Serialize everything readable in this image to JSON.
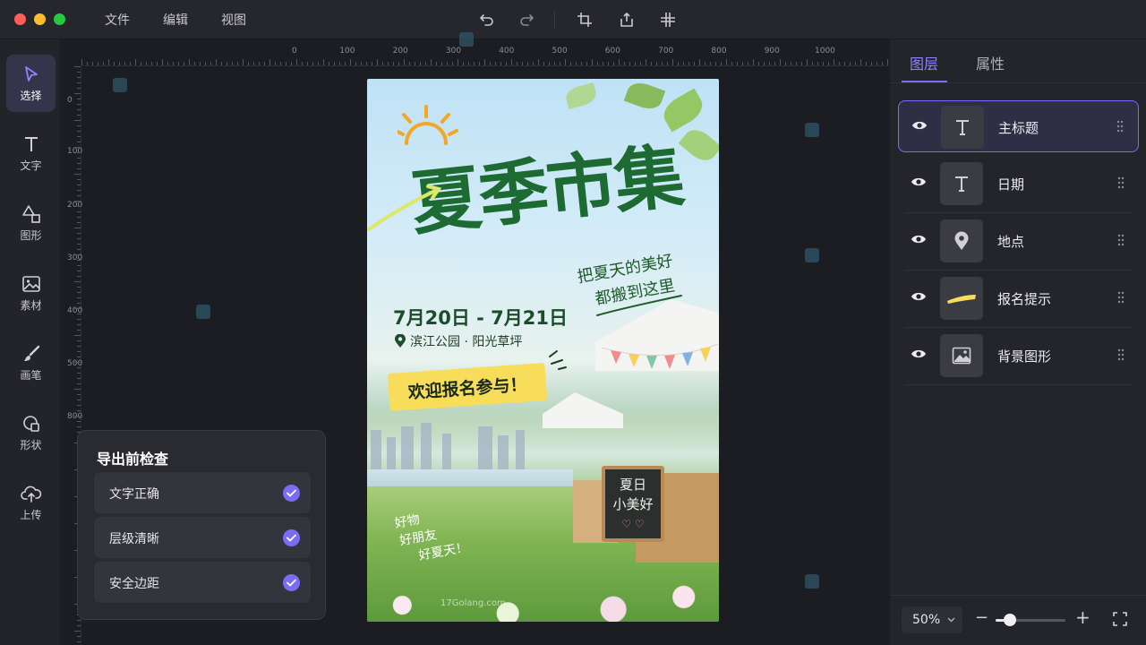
{
  "window": {
    "traffic_colors": [
      "#fe5f57",
      "#febc2e",
      "#28c840"
    ]
  },
  "menu": {
    "items": [
      "文件",
      "编辑",
      "视图"
    ]
  },
  "toolbar": {
    "icons": [
      "undo-icon",
      "redo-icon",
      "crop-icon",
      "export-icon",
      "align-icon"
    ]
  },
  "left_tools": [
    {
      "label": "选择",
      "icon": "cursor-icon",
      "active": true
    },
    {
      "label": "文字",
      "icon": "text-icon",
      "active": false
    },
    {
      "label": "图形",
      "icon": "shapes-icon",
      "active": false
    },
    {
      "label": "素材",
      "icon": "image-icon",
      "active": false
    },
    {
      "label": "画笔",
      "icon": "brush-icon",
      "active": false
    },
    {
      "label": "形状",
      "icon": "shape-icon",
      "active": false
    },
    {
      "label": "上传",
      "icon": "upload-icon",
      "active": false
    }
  ],
  "ruler": {
    "top": [
      "0",
      "100",
      "200",
      "300",
      "400",
      "500",
      "600",
      "700",
      "800",
      "900",
      "1000"
    ],
    "left": [
      "0",
      "100",
      "200",
      "300",
      "400",
      "500",
      "800"
    ]
  },
  "poster": {
    "title": "夏季市集",
    "slogan_line1": "把夏天的美好",
    "slogan_line2": "都搬到这里",
    "date": "7月20日 - 7月21日",
    "location": "滨江公园 · 阳光草坪",
    "signup": "欢迎报名参与！",
    "board_line1": "夏日",
    "board_line2": "小美好",
    "board_line3": "♡ ♡",
    "hand_line1": "好物",
    "hand_line2": "好朋友",
    "hand_line3": "好夏天！",
    "watermark": "17Golang.com"
  },
  "export_check": {
    "title": "导出前检查",
    "items": [
      {
        "label": "文字正确",
        "checked": true
      },
      {
        "label": "层级清晰",
        "checked": true
      },
      {
        "label": "安全边距",
        "checked": true
      }
    ],
    "accent": "#7b6cf6"
  },
  "right_panel": {
    "tabs": [
      {
        "label": "图层",
        "active": true
      },
      {
        "label": "属性",
        "active": false
      }
    ],
    "layers": [
      {
        "name": "主标题",
        "thumb": "text-icon",
        "active": true
      },
      {
        "name": "日期",
        "thumb": "text-icon",
        "active": false
      },
      {
        "name": "地点",
        "thumb": "location-pin-icon",
        "active": false
      },
      {
        "name": "报名提示",
        "thumb": "highlight-stroke-icon",
        "active": false
      },
      {
        "name": "背景图形",
        "thumb": "image-icon",
        "active": false
      }
    ]
  },
  "zoom": {
    "value": "50%",
    "level": 0.2
  }
}
